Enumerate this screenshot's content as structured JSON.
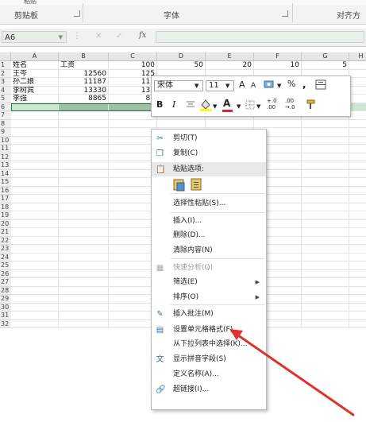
{
  "ribbon": {
    "partial_top": "粘贴",
    "groups": [
      "剪贴板",
      "字体",
      "对齐方"
    ]
  },
  "formula_bar": {
    "name_box": "A6",
    "cancel_symbol": "✕",
    "enter_symbol": "✓",
    "fx_label": "fx",
    "value": ""
  },
  "columns": [
    "A",
    "B",
    "C",
    "D",
    "E",
    "F",
    "G",
    "H"
  ],
  "rows": [
    {
      "n": "1",
      "cells": [
        "姓名",
        "工资",
        "100",
        "50",
        "20",
        "10",
        "5",
        ""
      ]
    },
    {
      "n": "2",
      "cells": [
        "王岑",
        "12560",
        "125",
        "",
        "",
        "",
        "",
        ""
      ]
    },
    {
      "n": "3",
      "cells": [
        "孙二娘",
        "11187",
        "111",
        "",
        "",
        "",
        "",
        ""
      ]
    },
    {
      "n": "4",
      "cells": [
        "李树宾",
        "13330",
        "133",
        "",
        "",
        "",
        "",
        ""
      ]
    },
    {
      "n": "5",
      "cells": [
        "李强",
        "8865",
        "88",
        "",
        "",
        "",
        "",
        ""
      ]
    },
    {
      "n": "6"
    },
    {
      "n": "7"
    },
    {
      "n": "8"
    },
    {
      "n": "9"
    },
    {
      "n": "10"
    },
    {
      "n": "11"
    },
    {
      "n": "12"
    },
    {
      "n": "13"
    },
    {
      "n": "14"
    },
    {
      "n": "15"
    },
    {
      "n": "16"
    },
    {
      "n": "17"
    },
    {
      "n": "18"
    },
    {
      "n": "19"
    },
    {
      "n": "20"
    },
    {
      "n": "21"
    },
    {
      "n": "22"
    },
    {
      "n": "23"
    },
    {
      "n": "24"
    },
    {
      "n": "25"
    },
    {
      "n": "26"
    },
    {
      "n": "27"
    },
    {
      "n": "28"
    },
    {
      "n": "29"
    },
    {
      "n": "30"
    },
    {
      "n": "31"
    },
    {
      "n": "32"
    }
  ],
  "mini_toolbar": {
    "font_name": "宋体",
    "font_size": "11",
    "grow_font": "A",
    "shrink_font": "A",
    "percent": "%",
    "comma": ",",
    "bold": "B",
    "italic": "I",
    "font_color_letter": "A",
    "increase_decimal": "+.0 .00",
    "decrease_decimal": ".00 →.0",
    "highlight_color": "#ffff00",
    "font_color": "#d9262c"
  },
  "context_menu": {
    "items": [
      {
        "label": "剪切(T)",
        "icon": "scissors-icon",
        "glyph": "✂"
      },
      {
        "label": "复制(C)",
        "icon": "copy-icon",
        "glyph": "❐"
      },
      {
        "label": "粘贴选项:",
        "icon": "paste-icon",
        "glyph": "📋",
        "header": true
      },
      {
        "label": "",
        "icon": "paste-options-icons"
      },
      {
        "label": "选择性粘贴(S)...",
        "icon": ""
      },
      {
        "label": "插入(I)...",
        "icon": ""
      },
      {
        "label": "删除(D)...",
        "icon": ""
      },
      {
        "label": "清除内容(N)",
        "icon": ""
      },
      {
        "label": "快速分析(Q)",
        "icon": "quick-analysis-icon",
        "glyph": "▦",
        "disabled": true
      },
      {
        "label": "筛选(E)",
        "icon": "",
        "submenu": true
      },
      {
        "label": "排序(O)",
        "icon": "",
        "submenu": true
      },
      {
        "label": "插入批注(M)",
        "icon": "comment-icon",
        "glyph": "✎"
      },
      {
        "label": "设置单元格格式(F)...",
        "icon": "format-cells-icon",
        "glyph": "▤"
      },
      {
        "label": "从下拉列表中选择(K)...",
        "icon": ""
      },
      {
        "label": "显示拼音字段(S)",
        "icon": "pinyin-icon",
        "glyph": "文"
      },
      {
        "label": "定义名称(A)...",
        "icon": ""
      },
      {
        "label": "超链接(I)...",
        "icon": "hyperlink-icon",
        "glyph": "🔗"
      }
    ],
    "submenu_arrow": "▶"
  },
  "colors": {
    "selection_fill": "#d0e4d3",
    "selection_dark": "#9fbfa6",
    "annotation_arrow": "#e0322d"
  }
}
